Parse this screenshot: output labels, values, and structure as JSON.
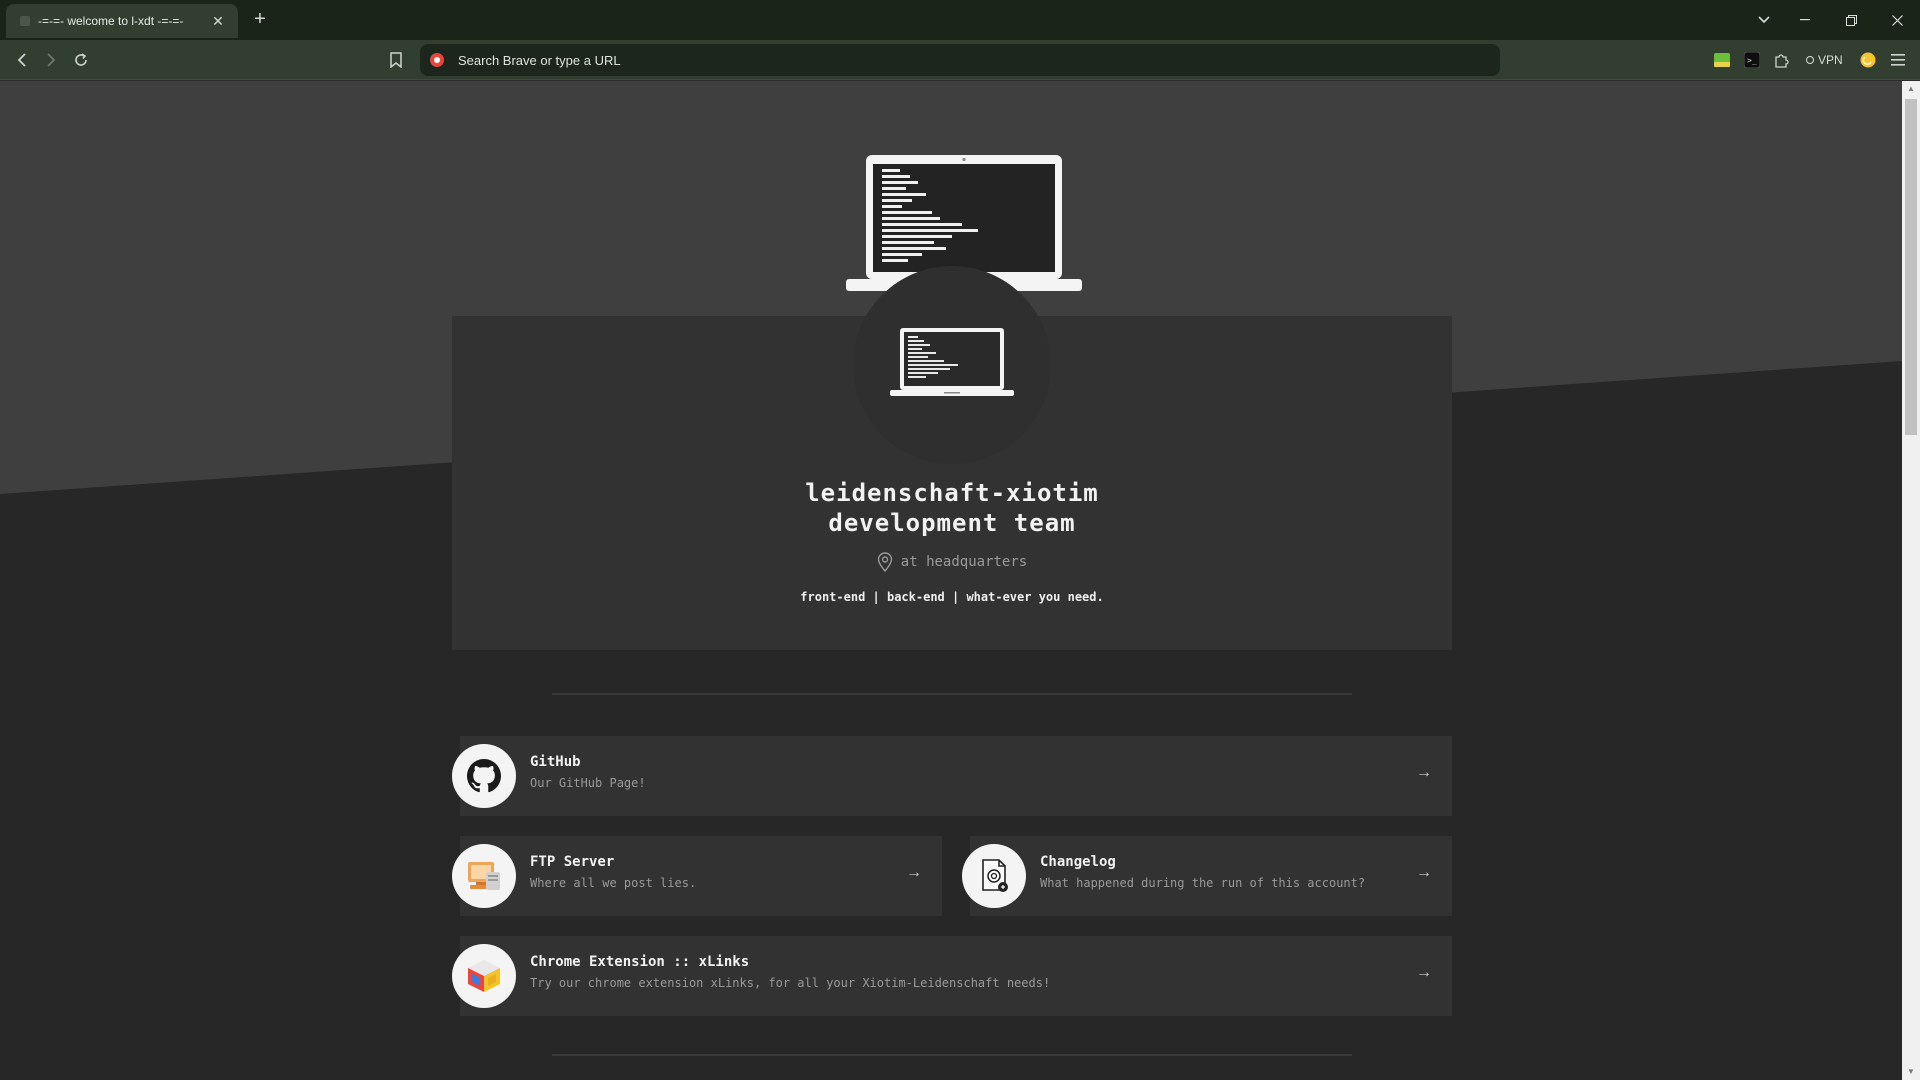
{
  "browser": {
    "tab_title": "-=-=- welcome to l-xdt -=-=-",
    "new_tab_symbol": "+",
    "url_placeholder": "Search Brave or type a URL",
    "vpn_label": "VPN"
  },
  "hero": {
    "team_name_line1": "leidenschaft-xiotim",
    "team_name_line2": "development team",
    "location": "at headquarters",
    "tagline": "front-end | back-end | what-ever you need."
  },
  "links": [
    {
      "title": "GitHub",
      "subtitle": "Our GitHub Page!",
      "icon": "github-icon"
    },
    {
      "title": "FTP Server",
      "subtitle": "Where all we post lies.",
      "icon": "ftp-server-icon"
    },
    {
      "title": "Changelog",
      "subtitle": "What happened during the run of this account?",
      "icon": "changelog-icon"
    },
    {
      "title": "Chrome Extension :: xLinks",
      "subtitle": "Try our chrome extension xLinks, for all your Xiotim-Leidenschaft needs!",
      "icon": "xlinks-cube-icon"
    }
  ],
  "colors": {
    "browser_frame": "#1a2419",
    "toolbar": "#313e30",
    "page_top": "#3f3f3f",
    "page_bottom": "#272727",
    "card": "#323232"
  }
}
